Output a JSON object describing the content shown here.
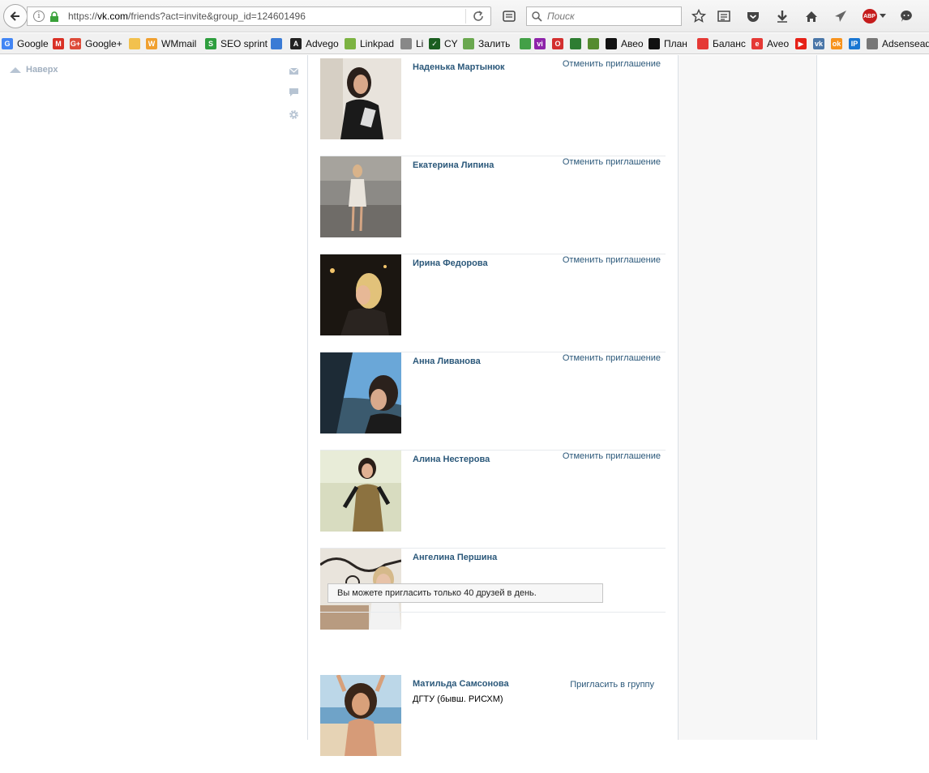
{
  "browser": {
    "url_prefix": "https://",
    "url_host": "vk.com",
    "url_path": "/friends?act=invite&group_id=124601496",
    "search_placeholder": "Поиск",
    "adblock_label": "ABP"
  },
  "bookmarks": [
    {
      "label": "Google",
      "icon": "google-icon",
      "color": "#4285f4",
      "glyph": "G"
    },
    {
      "label": "",
      "icon": "gmail-icon",
      "color": "#d93025",
      "glyph": "M"
    },
    {
      "label": "Google+",
      "icon": "google-plus-icon",
      "color": "#dd4b39",
      "glyph": "G+"
    },
    {
      "label": "",
      "icon": "chat-icon",
      "color": "#f2c14e",
      "glyph": ""
    },
    {
      "label": "WMmail",
      "icon": "wmmail-icon",
      "color": "#f0a030",
      "glyph": "W"
    },
    {
      "label": "SEO sprint",
      "icon": "seosprint-icon",
      "color": "#2e9e3e",
      "glyph": "S"
    },
    {
      "label": "",
      "icon": "stats-icon",
      "color": "#3a7bd5",
      "glyph": ""
    },
    {
      "label": "Advego",
      "icon": "advego-icon",
      "color": "#222222",
      "glyph": "A"
    },
    {
      "label": "Linkpad",
      "icon": "linkpad-icon",
      "color": "#7cb342",
      "glyph": ""
    },
    {
      "label": "Li",
      "icon": "liveinternet-icon",
      "color": "#888888",
      "glyph": ""
    },
    {
      "label": "CY",
      "icon": "checkmark-icon",
      "color": "#1b5e20",
      "glyph": "✓"
    },
    {
      "label": "Залить",
      "icon": "upload-icon",
      "color": "#6aa84f",
      "glyph": ""
    },
    {
      "label": "",
      "icon": "refresh-green-icon",
      "color": "#43a047",
      "glyph": ""
    },
    {
      "label": "",
      "icon": "vi-icon",
      "color": "#8e24aa",
      "glyph": "vi"
    },
    {
      "label": "",
      "icon": "opera-icon",
      "color": "#d32f2f",
      "glyph": "O"
    },
    {
      "label": "",
      "icon": "leaf-icon",
      "color": "#2e7d32",
      "glyph": ""
    },
    {
      "label": "",
      "icon": "cloud-icon",
      "color": "#558b2f",
      "glyph": ""
    },
    {
      "label": "Авео",
      "icon": "aveo-icon",
      "color": "#111111",
      "glyph": ""
    },
    {
      "label": "План",
      "icon": "plan-icon",
      "color": "#111111",
      "glyph": ""
    },
    {
      "label": "Баланс",
      "icon": "lifebuoy-icon",
      "color": "#e53935",
      "glyph": ""
    },
    {
      "label": "Aveo",
      "icon": "aveo-e-icon",
      "color": "#e53935",
      "glyph": "e"
    },
    {
      "label": "",
      "icon": "youtube-icon",
      "color": "#e62117",
      "glyph": "▶"
    },
    {
      "label": "",
      "icon": "vk-icon",
      "color": "#4a76a8",
      "glyph": "vk"
    },
    {
      "label": "",
      "icon": "odnoklassniki-icon",
      "color": "#f7931e",
      "glyph": "ok"
    },
    {
      "label": "",
      "icon": "ip-icon",
      "color": "#1976d2",
      "glyph": "IP"
    },
    {
      "label": "Adsensead",
      "icon": "globe-icon",
      "color": "#777777",
      "glyph": ""
    }
  ],
  "sidebar": {
    "top_label": "Наверх"
  },
  "friends": [
    {
      "name": "Наденька Мартынюк",
      "action": "Отменить приглашение",
      "subtitle": ""
    },
    {
      "name": "Екатерина Липина",
      "action": "Отменить приглашение",
      "subtitle": ""
    },
    {
      "name": "Ирина Федорова",
      "action": "Отменить приглашение",
      "subtitle": ""
    },
    {
      "name": "Анна Ливанова",
      "action": "Отменить приглашение",
      "subtitle": ""
    },
    {
      "name": "Алина Нестерова",
      "action": "Отменить приглашение",
      "subtitle": ""
    },
    {
      "name": "Ангелина Першина",
      "action": "",
      "subtitle": ""
    },
    {
      "name": "Матильда Самсонова",
      "action": "Пригласить в группу",
      "subtitle": "ДГТУ (бывш. РИСХМ)"
    }
  ],
  "notice": "Вы можете пригласить только 40 друзей в день.",
  "colors": {
    "link": "#2b587a",
    "accent": "#4a76a8"
  }
}
